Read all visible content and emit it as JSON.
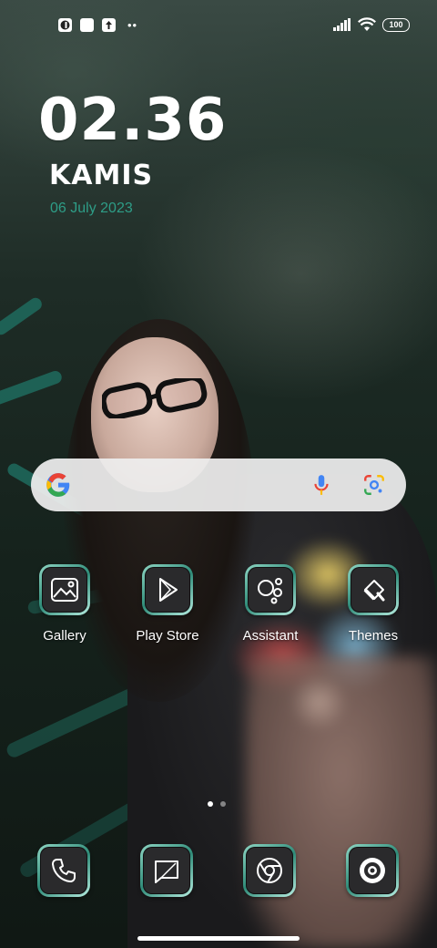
{
  "status_bar": {
    "left_icons": [
      "notification-app-icon",
      "square-notification-icon",
      "upload-notification-icon"
    ],
    "overflow_dots": "••",
    "right_icons": [
      "signal-icon",
      "wifi-icon"
    ],
    "battery": "100"
  },
  "clock_widget": {
    "time": "02.36",
    "day": "KAMIS",
    "date": "06 July 2023",
    "date_color": "#2e9d87"
  },
  "search_bar": {
    "icons": [
      "google-logo-icon",
      "microphone-icon",
      "google-lens-icon"
    ]
  },
  "apps": [
    {
      "label": "Gallery",
      "icon": "gallery-icon"
    },
    {
      "label": "Play Store",
      "icon": "play-store-icon"
    },
    {
      "label": "Assistant",
      "icon": "assistant-icon"
    },
    {
      "label": "Themes",
      "icon": "themes-icon"
    }
  ],
  "pager": {
    "pages": 2,
    "active": 1
  },
  "dock": [
    {
      "icon": "phone-icon"
    },
    {
      "icon": "messages-icon"
    },
    {
      "icon": "chrome-icon"
    },
    {
      "icon": "camera-icon"
    }
  ],
  "colors": {
    "icon_frame": "#2f8b78",
    "icon_fill": "#2a2a2c"
  }
}
